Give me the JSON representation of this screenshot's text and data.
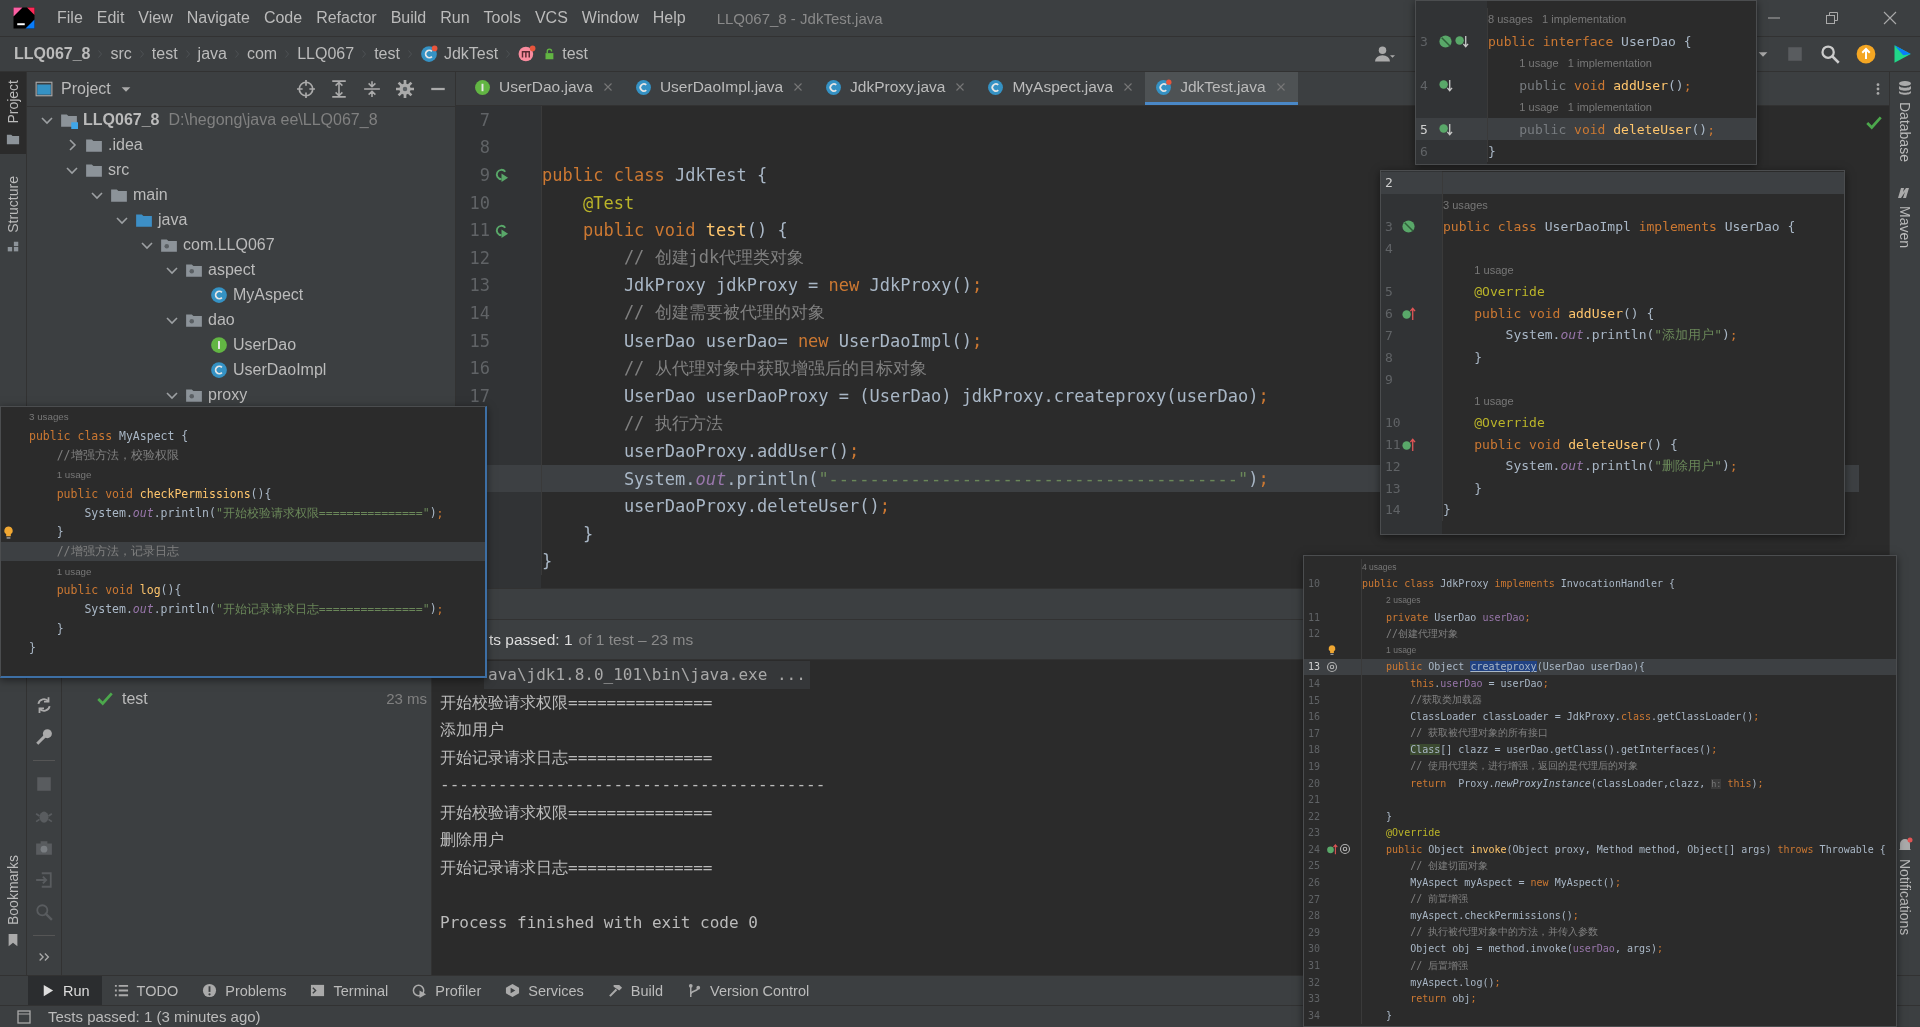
{
  "window": {
    "title": "LLQ067_8 - JdkTest.java"
  },
  "menu": [
    "File",
    "Edit",
    "View",
    "Navigate",
    "Code",
    "Refactor",
    "Build",
    "Run",
    "Tools",
    "VCS",
    "Window",
    "Help"
  ],
  "breadcrumb": [
    {
      "label": "LLQ067_8",
      "kind": "module"
    },
    {
      "label": "src",
      "kind": "folder"
    },
    {
      "label": "test",
      "kind": "folder"
    },
    {
      "label": "java",
      "kind": "folder"
    },
    {
      "label": "com",
      "kind": "folder"
    },
    {
      "label": "LLQ067",
      "kind": "folder"
    },
    {
      "label": "test",
      "kind": "folder"
    },
    {
      "label": "JdkTest",
      "kind": "test"
    },
    {
      "label": "test",
      "kind": "method"
    }
  ],
  "left_tool_tabs": [
    {
      "label": "Project",
      "selected": true
    },
    {
      "label": "Structure",
      "selected": false
    }
  ],
  "bookmarks_tab": {
    "label": "Bookmarks"
  },
  "right_tool_tabs": [
    {
      "label": "Database"
    },
    {
      "label": "Maven"
    },
    {
      "label": "Notifications"
    }
  ],
  "project_panel": {
    "title": "Project",
    "tree": [
      {
        "label": "LLQ067_8",
        "path": "D:\\hegong\\java ee\\LLQ067_8",
        "kind": "module",
        "expanded": true,
        "children": [
          {
            "label": ".idea",
            "kind": "folder",
            "expanded": false
          },
          {
            "label": "src",
            "kind": "folder",
            "expanded": true,
            "children": [
              {
                "label": "main",
                "kind": "folder",
                "expanded": true,
                "children": [
                  {
                    "label": "java",
                    "kind": "source",
                    "expanded": true,
                    "children": [
                      {
                        "label": "com.LLQ067",
                        "kind": "package",
                        "expanded": true,
                        "children": [
                          {
                            "label": "aspect",
                            "kind": "package",
                            "expanded": true,
                            "children": [
                              {
                                "label": "MyAspect",
                                "kind": "class"
                              }
                            ]
                          },
                          {
                            "label": "dao",
                            "kind": "package",
                            "expanded": true,
                            "children": [
                              {
                                "label": "UserDao",
                                "kind": "interface"
                              },
                              {
                                "label": "UserDaoImpl",
                                "kind": "class"
                              }
                            ]
                          },
                          {
                            "label": "proxy",
                            "kind": "package",
                            "expanded": true
                          }
                        ]
                      }
                    ]
                  }
                ]
              }
            ]
          }
        ]
      }
    ]
  },
  "editor_tabs": [
    {
      "label": "UserDao.java",
      "kind": "interface",
      "selected": false
    },
    {
      "label": "UserDaoImpl.java",
      "kind": "class",
      "selected": false
    },
    {
      "label": "JdkProxy.java",
      "kind": "class",
      "selected": false
    },
    {
      "label": "MyAspect.java",
      "kind": "class",
      "selected": false
    },
    {
      "label": "JdkTest.java",
      "kind": "test",
      "selected": true
    }
  ],
  "editor": {
    "lines": [
      {
        "kind": "code",
        "num": "7",
        "current": false
      },
      {
        "kind": "code",
        "num": "8",
        "current": false
      },
      {
        "kind": "code",
        "num": "9",
        "gutter": [
          {
            "kind": "run"
          }
        ],
        "current": false,
        "tokens": [
          {
            "kind": "kw",
            "text": "public class "
          },
          {
            "kind": "plain",
            "text": "JdkTest {"
          }
        ]
      },
      {
        "kind": "code",
        "num": "10",
        "current": false,
        "tokens": [
          {
            "kind": "ann",
            "text": "    @Test"
          }
        ]
      },
      {
        "kind": "code",
        "num": "11",
        "gutter": [
          {
            "kind": "run"
          }
        ],
        "current": false,
        "tokens": [
          {
            "kind": "kw",
            "text": "    public void "
          },
          {
            "kind": "decl",
            "text": "test"
          },
          {
            "kind": "plain",
            "text": "() {"
          }
        ]
      },
      {
        "kind": "code",
        "num": "12",
        "current": false,
        "tokens": [
          {
            "kind": "comment",
            "text": "        // 创建jdk代理类对象"
          }
        ]
      },
      {
        "kind": "code",
        "num": "13",
        "current": false,
        "tokens": [
          {
            "kind": "plain",
            "text": "        JdkProxy jdkProxy = "
          },
          {
            "kind": "kw",
            "text": "new "
          },
          {
            "kind": "plain",
            "text": "JdkProxy()"
          },
          {
            "kind": "kw",
            "text": ";"
          }
        ]
      },
      {
        "kind": "code",
        "num": "14",
        "current": false,
        "tokens": [
          {
            "kind": "comment",
            "text": "        // 创建需要被代理的对象"
          }
        ]
      },
      {
        "kind": "code",
        "num": "15",
        "current": false,
        "tokens": [
          {
            "kind": "plain",
            "text": "        UserDao userDao= "
          },
          {
            "kind": "kw",
            "text": "new "
          },
          {
            "kind": "plain",
            "text": "UserDaoImpl()"
          },
          {
            "kind": "kw",
            "text": ";"
          }
        ]
      },
      {
        "kind": "code",
        "num": "16",
        "current": false,
        "tokens": [
          {
            "kind": "comment",
            "text": "        // 从代理对象中获取增强后的目标对象"
          }
        ]
      },
      {
        "kind": "code",
        "num": "17",
        "current": false,
        "tokens": [
          {
            "kind": "plain",
            "text": "        UserDao userDaoProxy = (UserDao) jdkProxy.createproxy(userDao)"
          },
          {
            "kind": "kw",
            "text": ";"
          }
        ]
      },
      {
        "kind": "code",
        "current": false,
        "tokens": [
          {
            "kind": "comment",
            "text": "        // 执行方法"
          }
        ]
      },
      {
        "kind": "code",
        "current": false,
        "tokens": [
          {
            "kind": "plain",
            "text": "        userDaoProxy.addUser()"
          },
          {
            "kind": "kw",
            "text": ";"
          }
        ]
      },
      {
        "kind": "code",
        "current": true,
        "tokens": [
          {
            "kind": "plain",
            "text": "        System."
          },
          {
            "kind": "static",
            "text": "out"
          },
          {
            "kind": "plain",
            "text": ".println("
          },
          {
            "kind": "str",
            "text": "\"----------------------------------------\""
          },
          {
            "kind": "plain",
            "text": ")"
          },
          {
            "kind": "kw",
            "text": ";"
          }
        ]
      },
      {
        "kind": "code",
        "current": false,
        "tokens": [
          {
            "kind": "plain",
            "text": "        userDaoProxy.deleteUser()"
          },
          {
            "kind": "kw",
            "text": ";"
          }
        ]
      },
      {
        "kind": "code",
        "current": false,
        "tokens": [
          {
            "kind": "plain",
            "text": "    }"
          }
        ]
      },
      {
        "kind": "code",
        "current": false,
        "tokens": [
          {
            "kind": "plain",
            "text": "}"
          }
        ]
      }
    ]
  },
  "run_panel": {
    "summary": "ts passed: 1",
    "summary_detail": "of 1 test – 23 ms",
    "tests": [
      {
        "name": "test",
        "passed": true,
        "duration": "23 ms"
      }
    ],
    "console": [
      {
        "kind": "command",
        "text": "ava\\jdk1.8.0_101\\bin\\java.exe ..."
      },
      {
        "kind": "output",
        "text": "开始校验请求权限==============="
      },
      {
        "kind": "output",
        "text": "添加用户"
      },
      {
        "kind": "output",
        "text": "开始记录请求日志==============="
      },
      {
        "kind": "output",
        "text": "----------------------------------------"
      },
      {
        "kind": "output",
        "text": "开始校验请求权限==============="
      },
      {
        "kind": "output",
        "text": "删除用户"
      },
      {
        "kind": "output",
        "text": "开始记录请求日志==============="
      },
      {
        "kind": "exit",
        "text": "Process finished with exit code 0"
      }
    ]
  },
  "bottom_tools": [
    {
      "label": "Run",
      "kind": "run",
      "selected": true
    },
    {
      "label": "TODO",
      "kind": "todo",
      "selected": false
    },
    {
      "label": "Problems",
      "kind": "problems",
      "selected": false
    },
    {
      "label": "Terminal",
      "kind": "terminal",
      "selected": false
    },
    {
      "label": "Profiler",
      "kind": "profiler",
      "selected": false
    },
    {
      "label": "Services",
      "kind": "services",
      "selected": false
    },
    {
      "label": "Build",
      "kind": "build",
      "selected": false
    },
    {
      "label": "Version Control",
      "kind": "vcs",
      "selected": false
    }
  ],
  "status_bar": {
    "message": "Tests passed: 1 (3 minutes ago)"
  },
  "popups": [
    {
      "lines": [
        {
          "kind": "hint",
          "indented": false,
          "current": false,
          "text": "3 usages"
        },
        {
          "kind": "code",
          "current": false,
          "tokens": [
            {
              "kind": "kw",
              "text": "public class "
            },
            {
              "kind": "plain",
              "text": "MyAspect {"
            }
          ]
        },
        {
          "kind": "code",
          "current": false,
          "tokens": [
            {
              "kind": "comment",
              "text": "    //增强方法，校验权限"
            }
          ]
        },
        {
          "kind": "hint",
          "indented": true,
          "current": false,
          "text": "1 usage"
        },
        {
          "kind": "code",
          "current": false,
          "tokens": [
            {
              "kind": "kw",
              "text": "    public void "
            },
            {
              "kind": "decl",
              "text": "checkPermissions"
            },
            {
              "kind": "plain",
              "text": "(){"
            }
          ]
        },
        {
          "kind": "code",
          "current": false,
          "tokens": [
            {
              "kind": "plain",
              "text": "        System."
            },
            {
              "kind": "static",
              "text": "out"
            },
            {
              "kind": "plain",
              "text": ".println("
            },
            {
              "kind": "str",
              "text": "\"开始校验请求权限===============\""
            },
            {
              "kind": "plain",
              "text": ")"
            },
            {
              "kind": "kw",
              "text": ";"
            }
          ]
        },
        {
          "kind": "code",
          "gutter": [
            {
              "kind": "bulb"
            }
          ],
          "current": false,
          "tokens": [
            {
              "kind": "plain",
              "text": "    }"
            }
          ]
        },
        {
          "kind": "code",
          "current": true,
          "tokens": [
            {
              "kind": "comment",
              "text": "    //增强方法，记录日志"
            }
          ]
        },
        {
          "kind": "hint",
          "indented": true,
          "current": false,
          "text": "1 usage"
        },
        {
          "kind": "code",
          "current": false,
          "tokens": [
            {
              "kind": "kw",
              "text": "    public void "
            },
            {
              "kind": "decl",
              "text": "log"
            },
            {
              "kind": "plain",
              "text": "(){"
            }
          ]
        },
        {
          "kind": "code",
          "current": false,
          "tokens": [
            {
              "kind": "plain",
              "text": "        System."
            },
            {
              "kind": "static",
              "text": "out"
            },
            {
              "kind": "plain",
              "text": ".println("
            },
            {
              "kind": "str",
              "text": "\"开始记录请求日志===============\""
            },
            {
              "kind": "plain",
              "text": ")"
            },
            {
              "kind": "kw",
              "text": ";"
            }
          ]
        },
        {
          "kind": "code",
          "current": false,
          "tokens": [
            {
              "kind": "plain",
              "text": "    }"
            }
          ]
        },
        {
          "kind": "code",
          "current": false,
          "tokens": [
            {
              "kind": "plain",
              "text": "}"
            }
          ]
        }
      ]
    },
    {
      "lines": [
        {
          "kind": "hint",
          "indented": false,
          "current": false,
          "text": "8 usages   1 implementation"
        },
        {
          "kind": "code",
          "num": "3",
          "gutter": [
            {
              "kind": "bean"
            },
            {
              "kind": "impl"
            }
          ],
          "current": false,
          "tokens": [
            {
              "kind": "kw",
              "text": "public interface "
            },
            {
              "kind": "plain",
              "text": "UserDao {"
            }
          ]
        },
        {
          "kind": "hint",
          "indented": true,
          "current": false,
          "text": "1 usage   1 implementation"
        },
        {
          "kind": "code",
          "num": "4",
          "gutter": [
            {
              "kind": "impl"
            }
          ],
          "current": false,
          "tokens": [
            {
              "kind": "dim",
              "text": "    public "
            },
            {
              "kind": "kw",
              "text": "void "
            },
            {
              "kind": "decl",
              "text": "addUser"
            },
            {
              "kind": "plain",
              "text": "()"
            },
            {
              "kind": "kw",
              "text": ";"
            }
          ]
        },
        {
          "kind": "hint",
          "indented": true,
          "current": false,
          "text": "1 usage   1 implementation"
        },
        {
          "kind": "code",
          "num": "5",
          "gutter": [
            {
              "kind": "impl"
            }
          ],
          "current": true,
          "tokens": [
            {
              "kind": "dim",
              "text": "    public "
            },
            {
              "kind": "kw",
              "text": "void "
            },
            {
              "kind": "decl",
              "text": "deleteUser"
            },
            {
              "kind": "plain",
              "text": "()"
            },
            {
              "kind": "kw",
              "text": ";"
            }
          ]
        },
        {
          "kind": "code",
          "num": "6",
          "current": false,
          "tokens": [
            {
              "kind": "plain",
              "text": "}"
            }
          ]
        }
      ]
    },
    {
      "lines": [
        {
          "kind": "code",
          "num": "2",
          "current": true
        },
        {
          "kind": "hint",
          "indented": false,
          "current": false,
          "text": "3 usages"
        },
        {
          "kind": "code",
          "num": "3",
          "gutter": [
            {
              "kind": "bean"
            }
          ],
          "current": false,
          "tokens": [
            {
              "kind": "kw",
              "text": "public class "
            },
            {
              "kind": "plain",
              "text": "UserDaoImpl "
            },
            {
              "kind": "kw",
              "text": "implements "
            },
            {
              "kind": "plain",
              "text": "UserDao {"
            }
          ]
        },
        {
          "kind": "code",
          "num": "4",
          "current": false
        },
        {
          "kind": "hint",
          "indented": true,
          "current": false,
          "text": "1 usage"
        },
        {
          "kind": "code",
          "num": "5",
          "current": false,
          "tokens": [
            {
              "kind": "ann",
              "text": "    @Override"
            }
          ]
        },
        {
          "kind": "code",
          "num": "6",
          "gutter": [
            {
              "kind": "override"
            }
          ],
          "current": false,
          "tokens": [
            {
              "kind": "kw",
              "text": "    public void "
            },
            {
              "kind": "decl",
              "text": "addUser"
            },
            {
              "kind": "plain",
              "text": "() {"
            }
          ]
        },
        {
          "kind": "code",
          "num": "7",
          "current": false,
          "tokens": [
            {
              "kind": "plain",
              "text": "        System."
            },
            {
              "kind": "static",
              "text": "out"
            },
            {
              "kind": "plain",
              "text": ".println("
            },
            {
              "kind": "str",
              "text": "\"添加用户\""
            },
            {
              "kind": "plain",
              "text": ")"
            },
            {
              "kind": "kw",
              "text": ";"
            }
          ]
        },
        {
          "kind": "code",
          "num": "8",
          "current": false,
          "tokens": [
            {
              "kind": "plain",
              "text": "    }"
            }
          ]
        },
        {
          "kind": "code",
          "num": "9",
          "current": false
        },
        {
          "kind": "hint",
          "indented": true,
          "current": false,
          "text": "1 usage"
        },
        {
          "kind": "code",
          "num": "10",
          "current": false,
          "tokens": [
            {
              "kind": "ann",
              "text": "    @Override"
            }
          ]
        },
        {
          "kind": "code",
          "num": "11",
          "gutter": [
            {
              "kind": "override"
            }
          ],
          "current": false,
          "tokens": [
            {
              "kind": "kw",
              "text": "    public void "
            },
            {
              "kind": "decl",
              "text": "deleteUser"
            },
            {
              "kind": "plain",
              "text": "() {"
            }
          ]
        },
        {
          "kind": "code",
          "num": "12",
          "current": false,
          "tokens": [
            {
              "kind": "plain",
              "text": "        System."
            },
            {
              "kind": "static",
              "text": "out"
            },
            {
              "kind": "plain",
              "text": ".println("
            },
            {
              "kind": "str",
              "text": "\"删除用户\""
            },
            {
              "kind": "plain",
              "text": ")"
            },
            {
              "kind": "kw",
              "text": ";"
            }
          ]
        },
        {
          "kind": "code",
          "num": "13",
          "current": false,
          "tokens": [
            {
              "kind": "plain",
              "text": "    }"
            }
          ]
        },
        {
          "kind": "code",
          "num": "14",
          "current": false,
          "tokens": [
            {
              "kind": "plain",
              "text": "}"
            }
          ]
        }
      ]
    },
    {
      "lines": [
        {
          "kind": "hint",
          "indented": false,
          "current": false,
          "text": "4 usages"
        },
        {
          "kind": "code",
          "num": "10",
          "current": false,
          "tokens": [
            {
              "kind": "kw",
              "text": "public class "
            },
            {
              "kind": "plain",
              "text": "JdkProxy "
            },
            {
              "kind": "kw",
              "text": "implements "
            },
            {
              "kind": "plain",
              "text": "InvocationHandler {"
            }
          ]
        },
        {
          "kind": "hint",
          "indented": true,
          "current": false,
          "text": "2 usages"
        },
        {
          "kind": "code",
          "num": "11",
          "current": false,
          "tokens": [
            {
              "kind": "kw",
              "text": "    private "
            },
            {
              "kind": "plain",
              "text": "UserDao "
            },
            {
              "kind": "field",
              "text": "userDao"
            },
            {
              "kind": "kw",
              "text": ";"
            }
          ]
        },
        {
          "kind": "code",
          "num": "12",
          "current": false,
          "tokens": [
            {
              "kind": "comment",
              "text": "    //创建代理对象"
            }
          ]
        },
        {
          "kind": "hint",
          "indented": true,
          "gutter": [
            {
              "kind": "bulb"
            }
          ],
          "current": false,
          "text": "1 usage"
        },
        {
          "kind": "code",
          "num": "13",
          "gutter": [
            {
              "kind": "at"
            }
          ],
          "current": true,
          "tokens": [
            {
              "kind": "kw",
              "text": "    public "
            },
            {
              "kind": "plain",
              "text": "Object "
            },
            {
              "kind": "sel",
              "text": "createproxy"
            },
            {
              "kind": "plain",
              "text": "(UserDao userDao){"
            }
          ]
        },
        {
          "kind": "code",
          "num": "14",
          "current": false,
          "tokens": [
            {
              "kind": "kw",
              "text": "        this"
            },
            {
              "kind": "plain",
              "text": "."
            },
            {
              "kind": "field",
              "text": "userDao"
            },
            {
              "kind": "plain",
              "text": " = userDao"
            },
            {
              "kind": "kw",
              "text": ";"
            }
          ]
        },
        {
          "kind": "code",
          "num": "15",
          "current": false,
          "tokens": [
            {
              "kind": "comment",
              "text": "        //获取类加载器"
            }
          ]
        },
        {
          "kind": "code",
          "num": "16",
          "current": false,
          "tokens": [
            {
              "kind": "plain",
              "text": "        ClassLoader classLoader = JdkProxy."
            },
            {
              "kind": "kw",
              "text": "class"
            },
            {
              "kind": "plain",
              "text": ".getClassLoader()"
            },
            {
              "kind": "kw",
              "text": ";"
            }
          ]
        },
        {
          "kind": "code",
          "num": "17",
          "current": false,
          "tokens": [
            {
              "kind": "comment",
              "text": "        // 获取被代理对象的所有接口"
            }
          ]
        },
        {
          "kind": "code",
          "num": "18",
          "current": false,
          "tokens": [
            {
              "kind": "mark",
              "text": "        Class"
            },
            {
              "kind": "plain",
              "text": "[] clazz = userDao.getClass().getInterfaces()"
            },
            {
              "kind": "kw",
              "text": ";"
            }
          ]
        },
        {
          "kind": "code",
          "num": "19",
          "current": false,
          "tokens": [
            {
              "kind": "comment",
              "text": "        // 使用代理类，进行增强，返回的是代理后的对象"
            }
          ]
        },
        {
          "kind": "code",
          "num": "20",
          "current": false,
          "tokens": [
            {
              "kind": "kw",
              "text": "        return  "
            },
            {
              "kind": "plain",
              "text": "Proxy."
            },
            {
              "kind": "italic",
              "text": "newProxyInstance"
            },
            {
              "kind": "plain",
              "text": "(classLoader,clazz, "
            },
            {
              "kind": "inlay",
              "text": "h:"
            },
            {
              "kind": "kw",
              "text": " this"
            },
            {
              "kind": "plain",
              "text": ")"
            },
            {
              "kind": "kw",
              "text": ";"
            }
          ]
        },
        {
          "kind": "code",
          "num": "21",
          "current": false
        },
        {
          "kind": "code",
          "num": "22",
          "current": false,
          "tokens": [
            {
              "kind": "plain",
              "text": "    }"
            }
          ]
        },
        {
          "kind": "code",
          "num": "23",
          "current": false,
          "tokens": [
            {
              "kind": "ann",
              "text": "    @Override"
            }
          ]
        },
        {
          "kind": "code",
          "num": "24",
          "gutter": [
            {
              "kind": "override"
            },
            {
              "kind": "at"
            }
          ],
          "current": false,
          "tokens": [
            {
              "kind": "kw",
              "text": "    public "
            },
            {
              "kind": "plain",
              "text": "Object "
            },
            {
              "kind": "decl",
              "text": "invoke"
            },
            {
              "kind": "plain",
              "text": "(Object proxy, Method method, Object[] args) "
            },
            {
              "kind": "kw",
              "text": "throws "
            },
            {
              "kind": "plain",
              "text": "Throwable {"
            }
          ]
        },
        {
          "kind": "code",
          "num": "25",
          "current": false,
          "tokens": [
            {
              "kind": "comment",
              "text": "        // 创建切面对象"
            }
          ]
        },
        {
          "kind": "code",
          "num": "26",
          "current": false,
          "tokens": [
            {
              "kind": "plain",
              "text": "        MyAspect myAspect = "
            },
            {
              "kind": "kw",
              "text": "new "
            },
            {
              "kind": "plain",
              "text": "MyAspect()"
            },
            {
              "kind": "kw",
              "text": ";"
            }
          ]
        },
        {
          "kind": "code",
          "num": "27",
          "current": false,
          "tokens": [
            {
              "kind": "comment",
              "text": "        // 前置增强"
            }
          ]
        },
        {
          "kind": "code",
          "num": "28",
          "current": false,
          "tokens": [
            {
              "kind": "plain",
              "text": "        myAspect.checkPermissions()"
            },
            {
              "kind": "kw",
              "text": ";"
            }
          ]
        },
        {
          "kind": "code",
          "num": "29",
          "current": false,
          "tokens": [
            {
              "kind": "comment",
              "text": "        // 执行被代理对象中的方法，并传入参数"
            }
          ]
        },
        {
          "kind": "code",
          "num": "30",
          "current": false,
          "tokens": [
            {
              "kind": "plain",
              "text": "        Object obj = method.invoke("
            },
            {
              "kind": "field",
              "text": "userDao"
            },
            {
              "kind": "plain",
              "text": ", args)"
            },
            {
              "kind": "kw",
              "text": ";"
            }
          ]
        },
        {
          "kind": "code",
          "num": "31",
          "current": false,
          "tokens": [
            {
              "kind": "comment",
              "text": "        // 后置增强"
            }
          ]
        },
        {
          "kind": "code",
          "num": "32",
          "current": false,
          "tokens": [
            {
              "kind": "plain",
              "text": "        myAspect.log()"
            },
            {
              "kind": "kw",
              "text": ";"
            }
          ]
        },
        {
          "kind": "code",
          "num": "33",
          "current": false,
          "tokens": [
            {
              "kind": "kw",
              "text": "        return "
            },
            {
              "kind": "plain",
              "text": "obj"
            },
            {
              "kind": "kw",
              "text": ";"
            }
          ]
        },
        {
          "kind": "code",
          "num": "34",
          "current": false,
          "tokens": [
            {
              "kind": "plain",
              "text": "    }"
            }
          ]
        }
      ]
    }
  ]
}
